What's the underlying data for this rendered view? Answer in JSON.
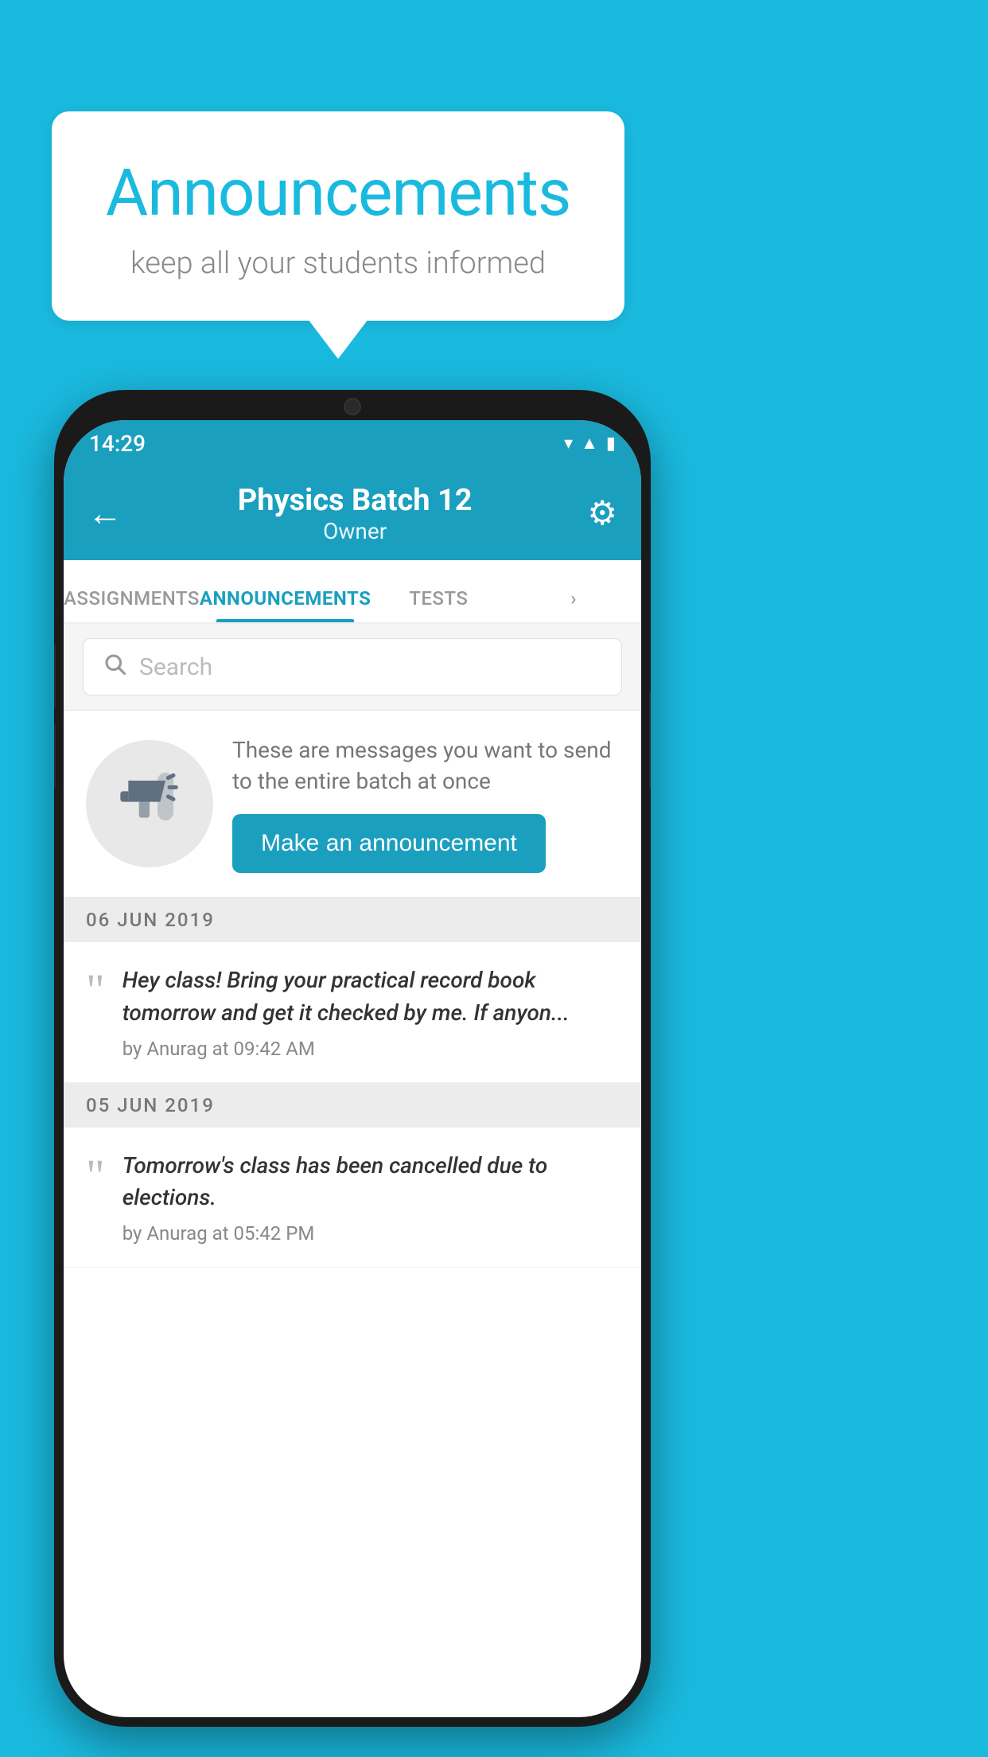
{
  "background": {
    "color": "#1ABADF"
  },
  "speech_bubble": {
    "title": "Announcements",
    "subtitle": "keep all your students informed"
  },
  "phone": {
    "status_bar": {
      "time": "14:29",
      "icons": [
        "wifi",
        "signal",
        "battery"
      ]
    },
    "app_bar": {
      "back_label": "←",
      "title": "Physics Batch 12",
      "subtitle": "Owner",
      "settings_label": "⚙"
    },
    "tabs": [
      {
        "label": "ASSIGNMENTS",
        "active": false
      },
      {
        "label": "ANNOUNCEMENTS",
        "active": true
      },
      {
        "label": "TESTS",
        "active": false
      },
      {
        "label": "···",
        "active": false
      }
    ],
    "search": {
      "placeholder": "Search"
    },
    "promo": {
      "description": "These are messages you want to send to the entire batch at once",
      "button_label": "Make an announcement"
    },
    "announcements": [
      {
        "date": "06  JUN  2019",
        "text": "Hey class! Bring your practical record book tomorrow and get it checked by me. If anyon...",
        "meta": "by Anurag at 09:42 AM"
      },
      {
        "date": "05  JUN  2019",
        "text": "Tomorrow's class has been cancelled due to elections.",
        "meta": "by Anurag at 05:42 PM"
      }
    ]
  }
}
